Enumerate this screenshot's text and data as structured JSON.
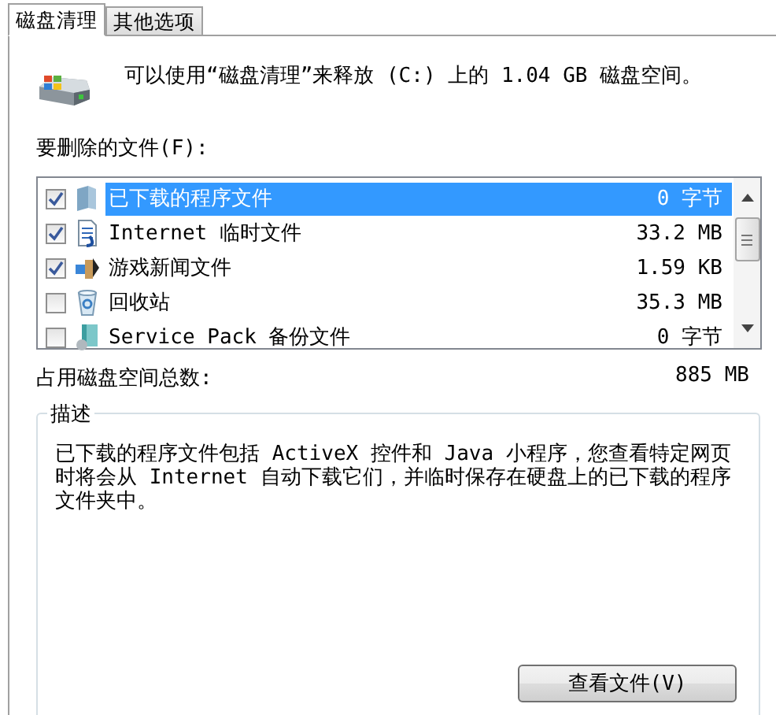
{
  "tabs": [
    {
      "label": "磁盘清理",
      "selected": true
    },
    {
      "label": "其他选项",
      "selected": false
    }
  ],
  "summary": "可以使用“磁盘清理”来释放  (C:) 上的 1.04 GB 磁盘空间。",
  "files_label": "要删除的文件(F):",
  "files": [
    {
      "kind": "folder",
      "name": "已下载的程序文件",
      "size": "0 字节",
      "checked": true,
      "selected": true
    },
    {
      "kind": "document",
      "name": "Internet 临时文件",
      "size": "33.2 MB",
      "checked": true,
      "selected": false
    },
    {
      "kind": "game",
      "name": "游戏新闻文件",
      "size": "1.59 KB",
      "checked": true,
      "selected": false
    },
    {
      "kind": "bin",
      "name": "回收站",
      "size": "35.3 MB",
      "checked": false,
      "selected": false
    },
    {
      "kind": "pack",
      "name": "Service Pack 备份文件",
      "size": "0 字节",
      "checked": false,
      "selected": false
    }
  ],
  "total": {
    "label": "占用磁盘空间总数:",
    "value": "885 MB"
  },
  "description": {
    "title": "描述",
    "text": "已下载的程序文件包括 ActiveX 控件和 Java 小程序，您查看特定网页时将会从 Internet 自动下载它们，并临时保存在硬盘上的已下载的程序文件夹中。",
    "button": "查看文件(V)"
  }
}
